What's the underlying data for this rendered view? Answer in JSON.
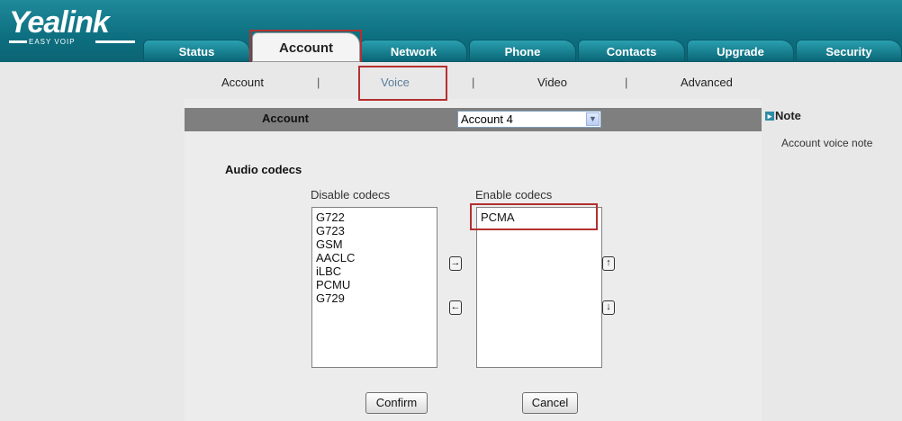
{
  "brand": {
    "name": "Yealink",
    "tagline": "EASY VOIP"
  },
  "tabs": [
    {
      "label": "Status"
    },
    {
      "label": "Account"
    },
    {
      "label": "Network"
    },
    {
      "label": "Phone"
    },
    {
      "label": "Contacts"
    },
    {
      "label": "Upgrade"
    },
    {
      "label": "Security"
    }
  ],
  "active_tab": "Account",
  "subnav": {
    "items": [
      "Account",
      "Voice",
      "Video",
      "Advanced"
    ],
    "separator": "|",
    "active": "Voice"
  },
  "account": {
    "label": "Account",
    "selected": "Account 4"
  },
  "audio": {
    "title": "Audio codecs",
    "disabled_label": "Disable codecs",
    "enabled_label": "Enable codecs",
    "disabled_codecs": [
      "G722",
      "G723",
      "GSM",
      "AACLC",
      "iLBC",
      "PCMU",
      "G729"
    ],
    "enabled_codecs": [
      "PCMA"
    ]
  },
  "buttons": {
    "confirm": "Confirm",
    "cancel": "Cancel"
  },
  "note": {
    "title": "Note",
    "text": "Account voice note"
  },
  "colors": {
    "header": "#0d6f80",
    "highlight": "#b43030",
    "panel_bar": "#7f7f7f"
  }
}
